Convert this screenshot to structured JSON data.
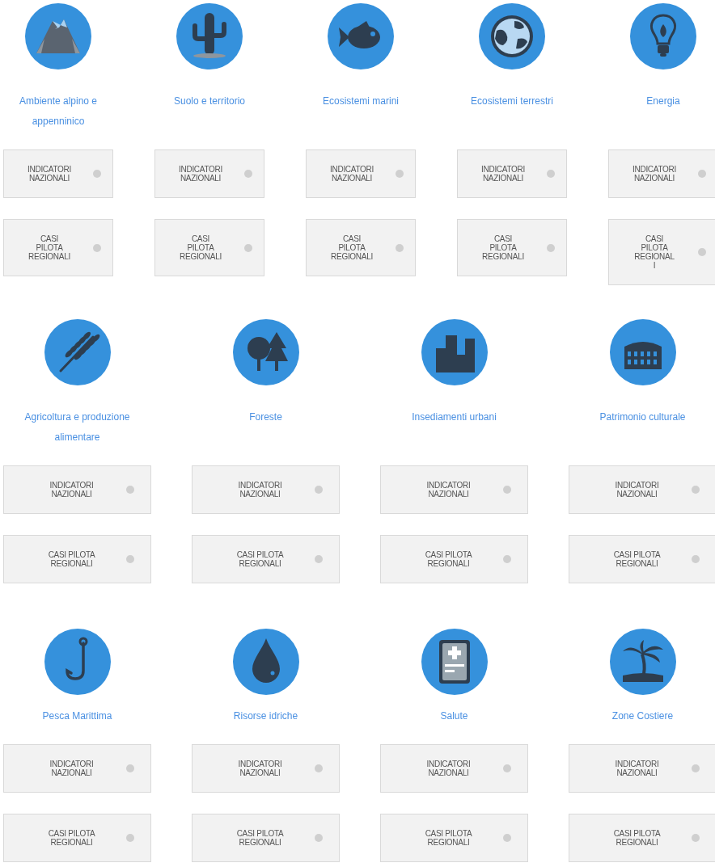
{
  "sections": [
    {
      "topics": [
        {
          "kind": "mountain",
          "title": "Ambiente alpino e appenninico",
          "buttons": [
            {
              "label": "INDICATORI\nNAZIONALI"
            },
            {
              "label": "CASI\nPILOTA\nREGIONALI"
            }
          ]
        },
        {
          "kind": "cactus",
          "title": "Suolo e territorio",
          "buttons": [
            {
              "label": "INDICATORI\nNAZIONALI"
            },
            {
              "label": "CASI\nPILOTA\nREGIONALI"
            }
          ]
        },
        {
          "kind": "fish",
          "title": "Ecosistemi marini",
          "buttons": [
            {
              "label": "INDICATORI\nNAZIONALI"
            },
            {
              "label": "CASI\nPILOTA\nREGIONALI"
            }
          ]
        },
        {
          "kind": "globe",
          "title": "Ecosistemi terrestri",
          "buttons": [
            {
              "label": "INDICATORI\nNAZIONALI"
            },
            {
              "label": "CASI\nPILOTA\nREGIONALI"
            }
          ]
        },
        {
          "kind": "bulb",
          "title": "Energia",
          "buttons": [
            {
              "label": "INDICATORI\nNAZIONALI"
            },
            {
              "label": "CASI\nPILOTA\nREGIONAL\nI"
            }
          ]
        }
      ]
    },
    {
      "topics": [
        {
          "kind": "wheat",
          "title": "Agricoltura e produzione alimentare",
          "buttons": [
            {
              "label": "INDICATORI\nNAZIONALI"
            },
            {
              "label": "CASI PILOTA\nREGIONALI"
            }
          ]
        },
        {
          "kind": "trees",
          "title": "Foreste",
          "buttons": [
            {
              "label": "INDICATORI\nNAZIONALI"
            },
            {
              "label": "CASI PILOTA\nREGIONALI"
            }
          ]
        },
        {
          "kind": "buildings",
          "title": "Insediamenti urbani",
          "buttons": [
            {
              "label": "INDICATORI\nNAZIONALI"
            },
            {
              "label": "CASI PILOTA\nREGIONALI"
            }
          ]
        },
        {
          "kind": "colosseum",
          "title": "Patrimonio culturale",
          "buttons": [
            {
              "label": "INDICATORI\nNAZIONALI"
            },
            {
              "label": "CASI PILOTA\nREGIONALI"
            }
          ]
        }
      ]
    },
    {
      "topics": [
        {
          "kind": "hook",
          "title": "Pesca Marittima",
          "buttons": [
            {
              "label": "INDICATORI\nNAZIONALI"
            },
            {
              "label": "CASI PILOTA\nREGIONALI"
            }
          ]
        },
        {
          "kind": "drop",
          "title": "Risorse idriche",
          "buttons": [
            {
              "label": "INDICATORI\nNAZIONALI"
            },
            {
              "label": "CASI PILOTA\nREGIONALI"
            }
          ]
        },
        {
          "kind": "medical",
          "title": "Salute",
          "buttons": [
            {
              "label": "INDICATORI\nNAZIONALI"
            },
            {
              "label": "CASI PILOTA\nREGIONALI"
            }
          ]
        },
        {
          "kind": "palm",
          "title": "Zone Costiere",
          "buttons": [
            {
              "label": "INDICATORI\nNAZIONALI"
            },
            {
              "label": "CASI PILOTA\nREGIONALI"
            }
          ]
        }
      ]
    }
  ]
}
